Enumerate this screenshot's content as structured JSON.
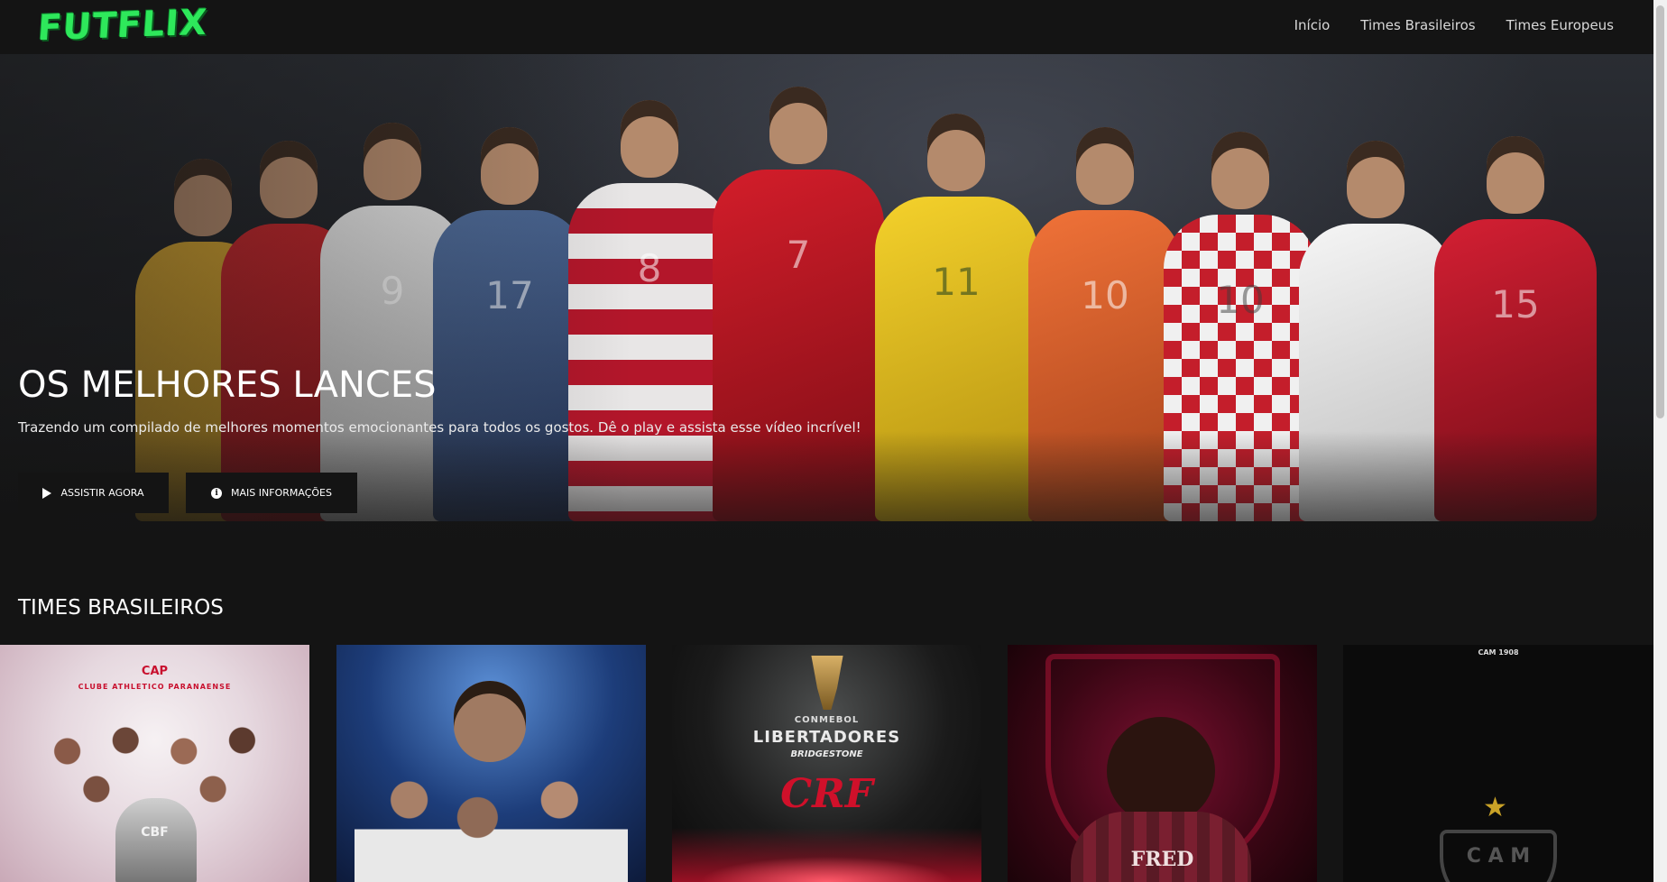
{
  "header": {
    "logo": "FUTFLIX",
    "nav": [
      "Início",
      "Times Brasileiros",
      "Times Europeus"
    ]
  },
  "hero": {
    "title": "OS MELHORES LANCES",
    "description": "Trazendo um compilado de melhores momentos emocionantes para todos os gostos. Dê o play e assista esse vídeo incrível!",
    "play_label": "ASSISTIR AGORA",
    "info_label": "MAIS INFORMAÇÕES",
    "player_numbers": [
      "9",
      "17",
      "8",
      "7",
      "11",
      "10",
      "10",
      "15"
    ]
  },
  "section": {
    "title": "TIMES BRASILEIROS"
  },
  "cards": [
    {
      "text": "CAP",
      "subtext": "CLUBE ATHLETICO PARANAENSE",
      "badge": "CBF"
    },
    {
      "text": ""
    },
    {
      "text": "CONMEBOL",
      "subtext": "LIBERTADORES",
      "sponsor": "BRIDGESTONE",
      "badge": "CRF"
    },
    {
      "text": "FRED"
    },
    {
      "text": "CAM 1908",
      "badge": "C A M"
    }
  ],
  "colors": {
    "background": "#141414",
    "logo": "#2ee85b",
    "accent_red": "#d0102a"
  }
}
